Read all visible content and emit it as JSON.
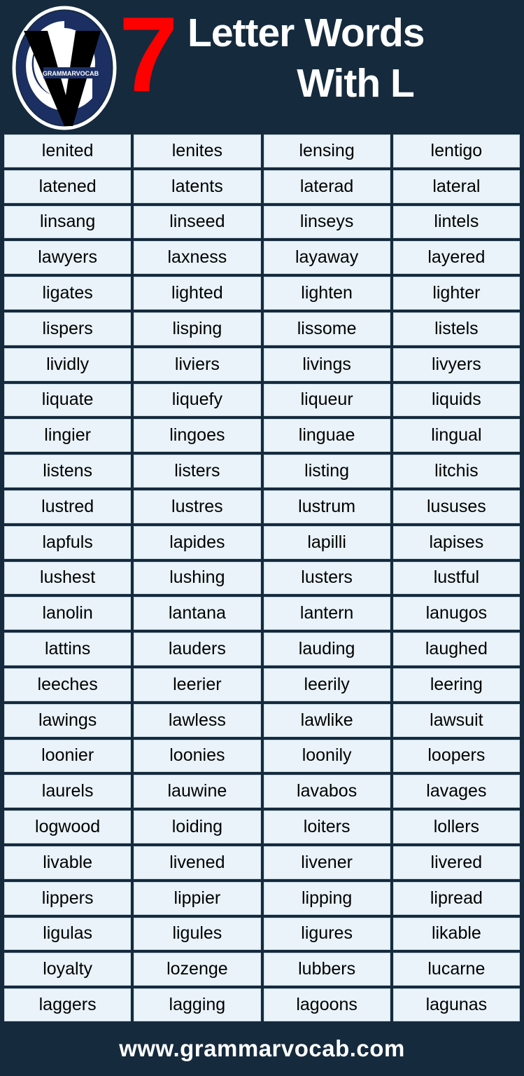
{
  "header": {
    "logo": {
      "brand_text": "GRAMMARVOCAB",
      "oval_color": "#1b2f63",
      "v_color": "#000000",
      "ring_color": "#ffffff"
    },
    "number": "7",
    "number_color": "#ff0000",
    "title_line1": "Letter Words",
    "title_line2": "With L",
    "title_color": "#ffffff",
    "background_color": "#152a3d"
  },
  "grid": {
    "columns": 4,
    "rows": 25,
    "cell_background": "#e9f3f9",
    "cell_text_color": "#000000",
    "words": [
      [
        "lenited",
        "lenites",
        "lensing",
        "lentigo"
      ],
      [
        "latened",
        "latents",
        "laterad",
        "lateral"
      ],
      [
        "linsang",
        "linseed",
        "linseys",
        "lintels"
      ],
      [
        "lawyers",
        "laxness",
        "layaway",
        "layered"
      ],
      [
        "ligates",
        "lighted",
        "lighten",
        "lighter"
      ],
      [
        "lispers",
        "lisping",
        "lissome",
        "listels"
      ],
      [
        "lividly",
        "liviers",
        "livings",
        "livyers"
      ],
      [
        "liquate",
        "liquefy",
        "liqueur",
        "liquids"
      ],
      [
        "lingier",
        "lingoes",
        "linguae",
        "lingual"
      ],
      [
        "listens",
        "listers",
        "listing",
        "litchis"
      ],
      [
        "lustred",
        "lustres",
        "lustrum",
        "lususes"
      ],
      [
        "lapfuls",
        "lapides",
        "lapilli",
        "lapises"
      ],
      [
        "lushest",
        "lushing",
        "lusters",
        "lustful"
      ],
      [
        "lanolin",
        "lantana",
        "lantern",
        "lanugos"
      ],
      [
        "lattins",
        "lauders",
        "lauding",
        "laughed"
      ],
      [
        "leeches",
        "leerier",
        "leerily",
        "leering"
      ],
      [
        "lawings",
        "lawless",
        "lawlike",
        "lawsuit"
      ],
      [
        "loonier",
        "loonies",
        "loonily",
        "loopers"
      ],
      [
        "laurels",
        "lauwine",
        "lavabos",
        "lavages"
      ],
      [
        "logwood",
        "loiding",
        "loiters",
        "lollers"
      ],
      [
        "livable",
        "livened",
        "livener",
        "livered"
      ],
      [
        "lippers",
        "lippier",
        "lipping",
        "lipread"
      ],
      [
        "ligulas",
        "ligules",
        "ligures",
        "likable"
      ],
      [
        "loyalty",
        "lozenge",
        "lubbers",
        "lucarne"
      ],
      [
        "laggers",
        "lagging",
        "lagoons",
        "lagunas"
      ]
    ]
  },
  "footer": {
    "website": "www.grammarvocab.com",
    "text_color": "#ffffff",
    "background_color": "#152a3d"
  }
}
